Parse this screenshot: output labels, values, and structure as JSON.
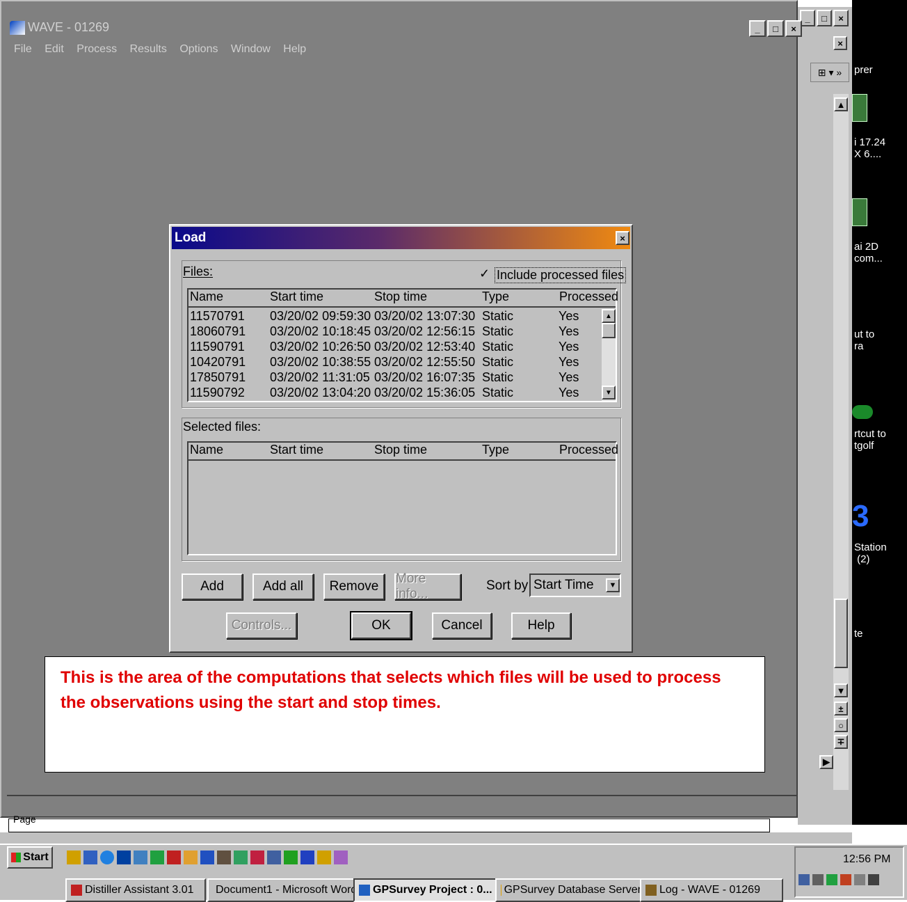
{
  "window": {
    "title": "WAVE - 01269"
  },
  "menu": [
    "File",
    "Edit",
    "Process",
    "Results",
    "Options",
    "Window",
    "Help"
  ],
  "right_window": {
    "partial_label": "prer"
  },
  "desktop_icons": [
    {
      "line1": "i 17.24",
      "line2": "X 6...."
    },
    {
      "line1": "ai 2D",
      "line2": "com..."
    },
    {
      "line1": "ut to",
      "line2": "ra"
    },
    {
      "line1": "rtcut to",
      "line2": "tgolf"
    },
    {
      "line1": "Station",
      "line2": "(2)"
    },
    {
      "line1": "te",
      "line2": ""
    }
  ],
  "dialog": {
    "title": "Load",
    "files_label": "Files:",
    "include_processed_label": "Include processed files",
    "columns": [
      "Name",
      "Start time",
      "Stop time",
      "Type",
      "Processed"
    ],
    "files": [
      [
        "11570791",
        "03/20/02 09:59:30",
        "03/20/02 13:07:30",
        "Static",
        "Yes"
      ],
      [
        "18060791",
        "03/20/02 10:18:45",
        "03/20/02 12:56:15",
        "Static",
        "Yes"
      ],
      [
        "11590791",
        "03/20/02 10:26:50",
        "03/20/02 12:53:40",
        "Static",
        "Yes"
      ],
      [
        "10420791",
        "03/20/02 10:38:55",
        "03/20/02 12:55:50",
        "Static",
        "Yes"
      ],
      [
        "17850791",
        "03/20/02 11:31:05",
        "03/20/02 16:07:35",
        "Static",
        "Yes"
      ],
      [
        "11590792",
        "03/20/02 13:04:20",
        "03/20/02 15:36:05",
        "Static",
        "Yes"
      ]
    ],
    "selected_label": "Selected files:",
    "buttons": {
      "add": "Add",
      "add_all": "Add all",
      "remove": "Remove",
      "more_info": "More info...",
      "controls": "Controls...",
      "ok": "OK",
      "cancel": "Cancel",
      "help": "Help"
    },
    "sort_by_label": "Sort by:",
    "sort_by_value": "Start Time"
  },
  "annotation": "This is the area of the computations that selects which files will be used to process the observations using the start and stop times.",
  "status_partial": "Page",
  "taskbar": {
    "start_label": "Start",
    "tasks": [
      "Distiller Assistant 3.01",
      "Document1 - Microsoft Word",
      "GPSurvey Project : 0...",
      "GPSurvey Database Server",
      "Log - WAVE - 01269"
    ],
    "clock": "12:56 PM"
  },
  "colors": {
    "annotation_text": "#e00000",
    "title_gradient_start": "#0a0a8a",
    "title_gradient_end": "#f08a10",
    "desktop": "#000000"
  }
}
